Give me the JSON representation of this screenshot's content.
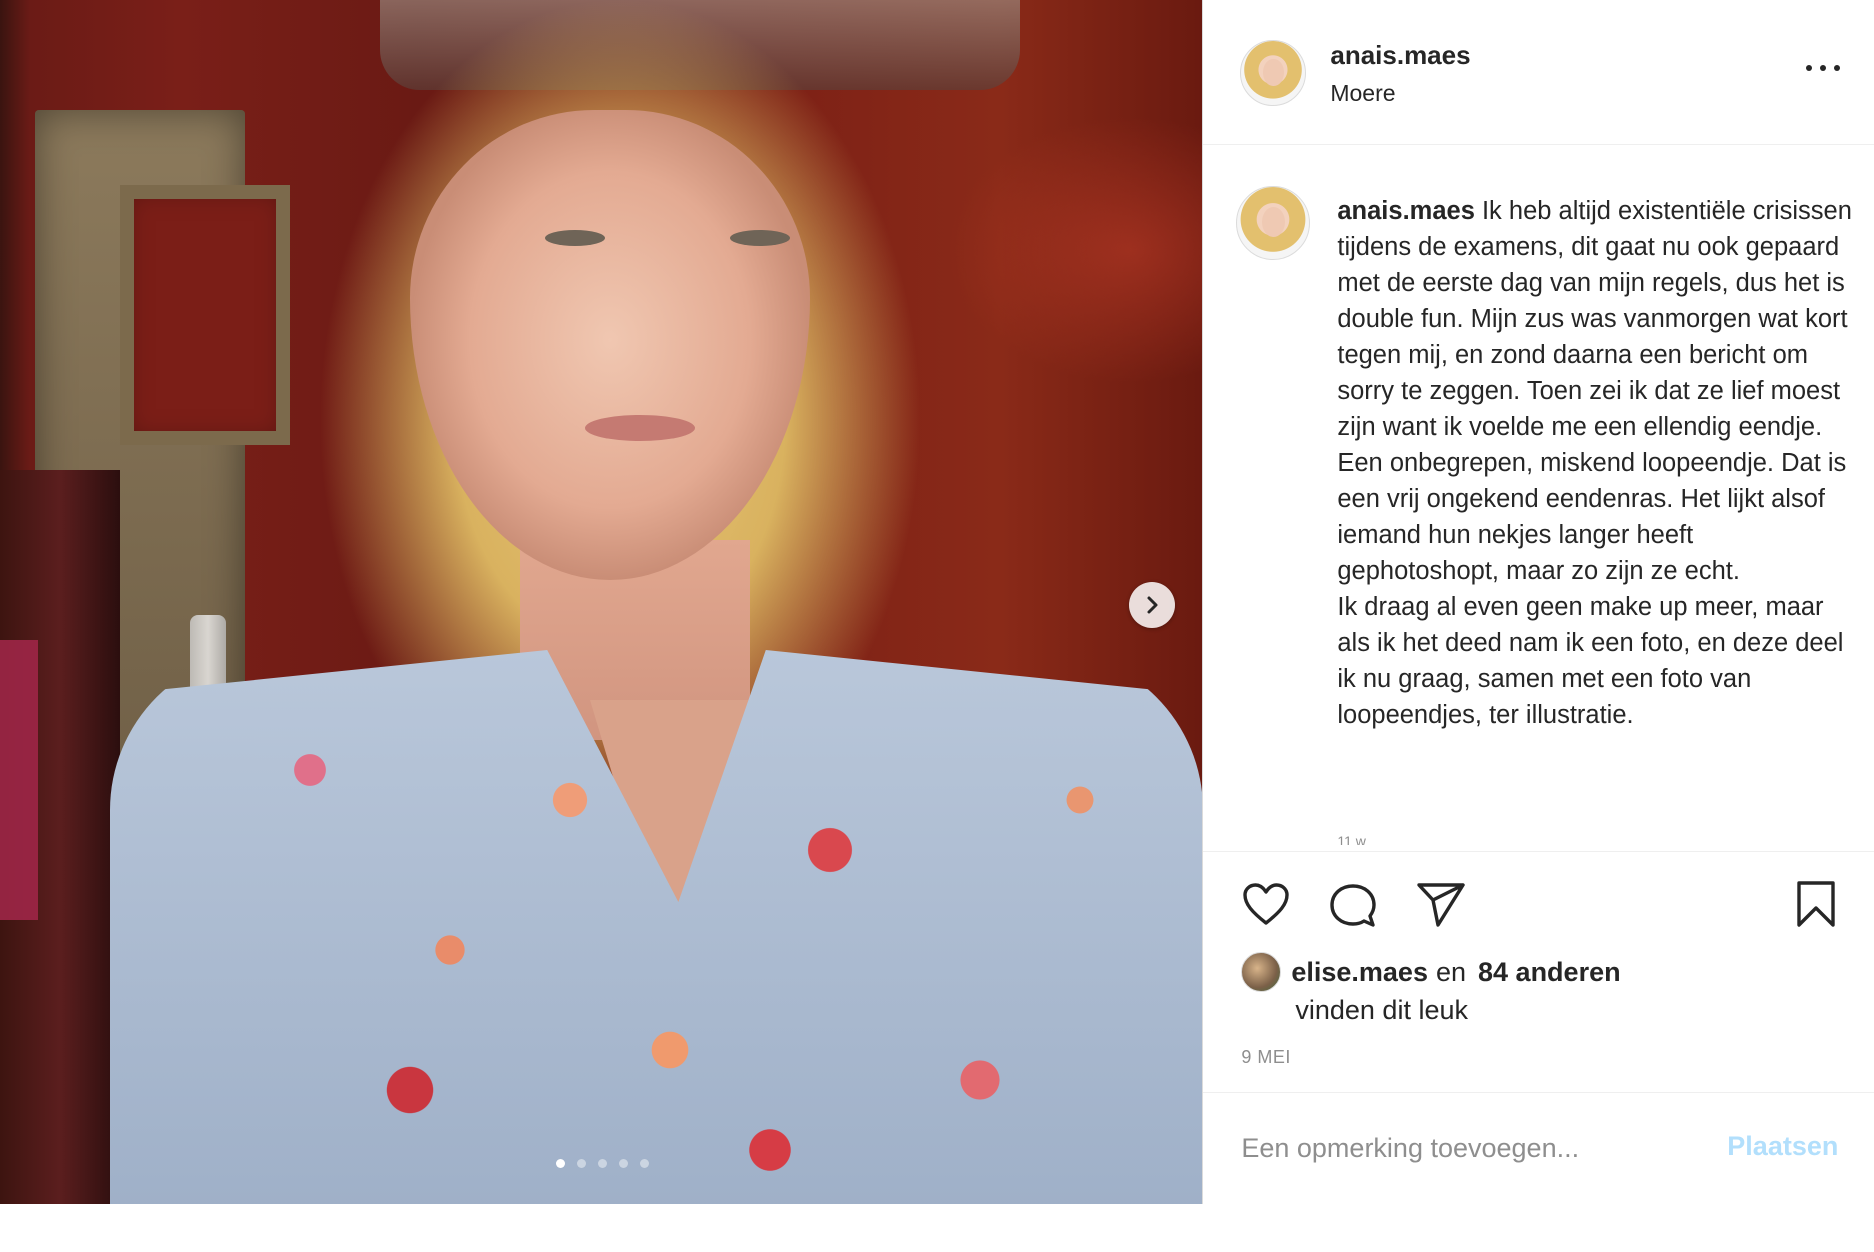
{
  "post": {
    "image_alt": "",
    "carousel": {
      "count": 5,
      "active_index": 0
    }
  },
  "header": {
    "username": "anais.maes",
    "location": "Moere"
  },
  "caption": {
    "username": "anais.maes",
    "text": "Ik heb altijd existentiële crisissen tijdens de examens, dit gaat nu ook gepaard met de eerste dag van mijn regels, dus het is double fun. Mijn zus was vanmorgen wat kort tegen mij, en zond daarna een bericht om sorry te zeggen. Toen zei ik dat ze lief moest zijn want ik voelde me een ellendig eendje. Een onbegrepen, miskend loopeendje. Dat is een vrij ongekend eendenras. Het lijkt alsof iemand hun nekjes langer heeft gephotoshopt, maar zo zijn ze echt.\nIk draag al even geen make up meer, maar als ik het deed nam ik een foto, en deze deel ik nu graag, samen met een foto van loopeendjes, ter illustratie.",
    "time_ago": "11 w"
  },
  "likes": {
    "liker": "elise.maes",
    "connector": "en",
    "others": "84 anderen",
    "suffix": "vinden dit leuk"
  },
  "date": "9 MEI",
  "add_comment": {
    "placeholder": "Een opmerking toevoegen...",
    "post_label": "Plaatsen"
  },
  "colors": {
    "text": "#262626",
    "secondary": "#8e8e8e",
    "disabled_blue": "#b2dffc",
    "border": "#dbdbdb"
  },
  "icons": [
    "next-arrow-icon",
    "more-options-icon",
    "heart-icon",
    "comment-icon",
    "share-icon",
    "bookmark-icon"
  ]
}
